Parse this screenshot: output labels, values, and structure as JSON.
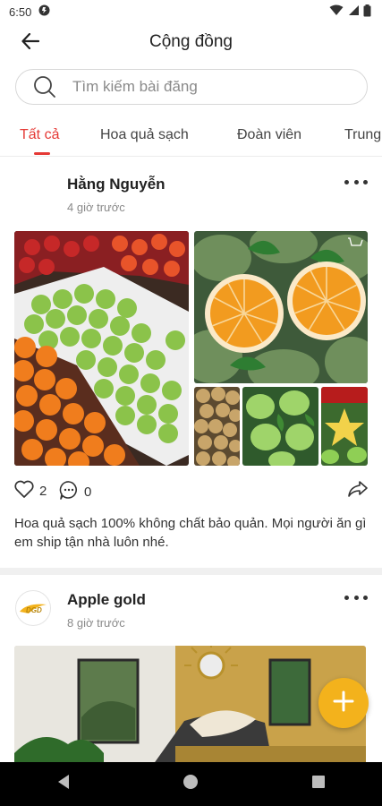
{
  "status_bar": {
    "time": "6:50"
  },
  "header": {
    "title": "Cộng đồng"
  },
  "search": {
    "placeholder": "Tìm kiếm bài đăng"
  },
  "tabs": [
    {
      "label": "Tất cả",
      "active": true
    },
    {
      "label": "Hoa quả sạch",
      "active": false
    },
    {
      "label": "Đoàn viên",
      "active": false
    },
    {
      "label": "Trung",
      "active": false
    }
  ],
  "posts": [
    {
      "author": "Hằng Nguyễn",
      "time": "4 giờ trước",
      "likes": "2",
      "comments": "0",
      "caption": "Hoa quả sạch 100% không chất bảo quản. Mọi người ăn gì em ship tận nhà luôn nhé."
    },
    {
      "author": "Apple gold",
      "time": "8 giờ trước",
      "avatar_logo": "DGD"
    }
  ],
  "colors": {
    "accent": "#e53935",
    "fab": "#f3b21c"
  }
}
